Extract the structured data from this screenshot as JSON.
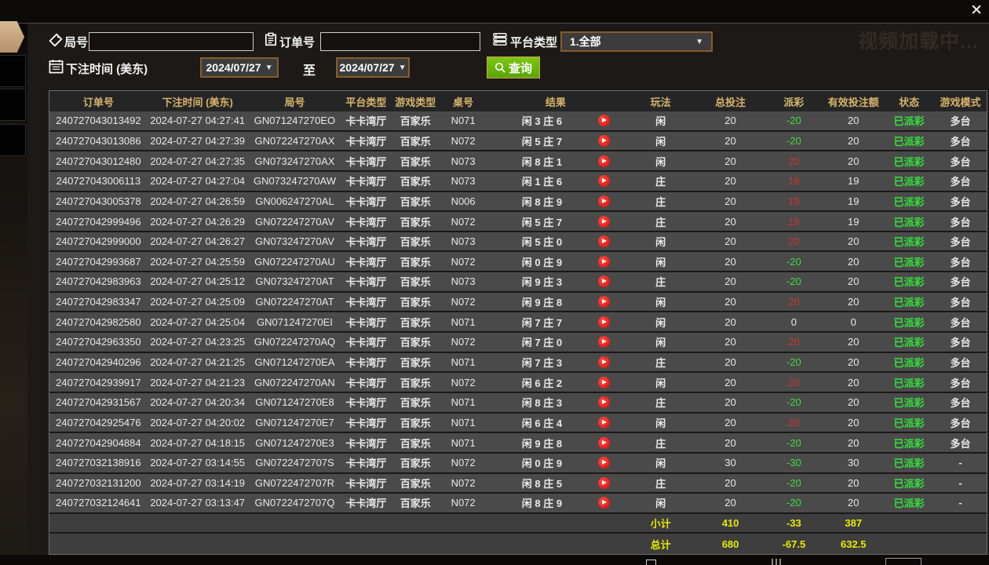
{
  "window": {
    "close_label": "✕"
  },
  "background": {
    "video_loading_text": "视频加载中..."
  },
  "filters": {
    "game_no_label": "局号",
    "game_no_value": "",
    "order_no_label": "订单号",
    "order_no_value": "",
    "platform_label": "平台类型",
    "platform_value": "1.全部",
    "bet_time_label": "下注时间 (美东)",
    "date_from": "2024/07/27",
    "to_label": "至",
    "date_to": "2024/07/27",
    "query_label": "查询",
    "dropdown_arrow": "▼"
  },
  "table": {
    "columns": [
      "订单号",
      "下注时间 (美东)",
      "局号",
      "平台类型",
      "游戏类型",
      "桌号",
      "结果",
      "玩法",
      "总投注",
      "派彩",
      "有效投注额",
      "状态",
      "游戏模式"
    ],
    "rows": [
      {
        "order_id": "240727043013492",
        "bet_time": "2024-07-27 04:27:41",
        "game_no": "GN071247270EO",
        "platform": "卡卡湾厅",
        "game_type": "百家乐",
        "table_no": "N071",
        "result": "闲 3 庄 6",
        "play": "闲",
        "total_bet": "20",
        "payout": "-20",
        "valid_bet": "20",
        "status": "已派彩",
        "mode": "多台"
      },
      {
        "order_id": "240727043013086",
        "bet_time": "2024-07-27 04:27:39",
        "game_no": "GN072247270AX",
        "platform": "卡卡湾厅",
        "game_type": "百家乐",
        "table_no": "N072",
        "result": "闲 5 庄 7",
        "play": "闲",
        "total_bet": "20",
        "payout": "-20",
        "valid_bet": "20",
        "status": "已派彩",
        "mode": "多台"
      },
      {
        "order_id": "240727043012480",
        "bet_time": "2024-07-27 04:27:35",
        "game_no": "GN073247270AX",
        "platform": "卡卡湾厅",
        "game_type": "百家乐",
        "table_no": "N073",
        "result": "闲 8 庄 1",
        "play": "闲",
        "total_bet": "20",
        "payout": "20",
        "valid_bet": "20",
        "status": "已派彩",
        "mode": "多台"
      },
      {
        "order_id": "240727043006113",
        "bet_time": "2024-07-27 04:27:04",
        "game_no": "GN073247270AW",
        "platform": "卡卡湾厅",
        "game_type": "百家乐",
        "table_no": "N073",
        "result": "闲 1 庄 6",
        "play": "庄",
        "total_bet": "20",
        "payout": "19",
        "valid_bet": "19",
        "status": "已派彩",
        "mode": "多台"
      },
      {
        "order_id": "240727043005378",
        "bet_time": "2024-07-27 04:26:59",
        "game_no": "GN006247270AL",
        "platform": "卡卡湾厅",
        "game_type": "百家乐",
        "table_no": "N006",
        "result": "闲 8 庄 9",
        "play": "庄",
        "total_bet": "20",
        "payout": "19",
        "valid_bet": "19",
        "status": "已派彩",
        "mode": "多台"
      },
      {
        "order_id": "240727042999496",
        "bet_time": "2024-07-27 04:26:29",
        "game_no": "GN072247270AV",
        "platform": "卡卡湾厅",
        "game_type": "百家乐",
        "table_no": "N072",
        "result": "闲 5 庄 7",
        "play": "庄",
        "total_bet": "20",
        "payout": "19",
        "valid_bet": "19",
        "status": "已派彩",
        "mode": "多台"
      },
      {
        "order_id": "240727042999000",
        "bet_time": "2024-07-27 04:26:27",
        "game_no": "GN073247270AV",
        "platform": "卡卡湾厅",
        "game_type": "百家乐",
        "table_no": "N073",
        "result": "闲 5 庄 0",
        "play": "闲",
        "total_bet": "20",
        "payout": "20",
        "valid_bet": "20",
        "status": "已派彩",
        "mode": "多台"
      },
      {
        "order_id": "240727042993687",
        "bet_time": "2024-07-27 04:25:59",
        "game_no": "GN072247270AU",
        "platform": "卡卡湾厅",
        "game_type": "百家乐",
        "table_no": "N072",
        "result": "闲 0 庄 9",
        "play": "闲",
        "total_bet": "20",
        "payout": "-20",
        "valid_bet": "20",
        "status": "已派彩",
        "mode": "多台"
      },
      {
        "order_id": "240727042983963",
        "bet_time": "2024-07-27 04:25:12",
        "game_no": "GN073247270AT",
        "platform": "卡卡湾厅",
        "game_type": "百家乐",
        "table_no": "N073",
        "result": "闲 9 庄 3",
        "play": "庄",
        "total_bet": "20",
        "payout": "-20",
        "valid_bet": "20",
        "status": "已派彩",
        "mode": "多台"
      },
      {
        "order_id": "240727042983347",
        "bet_time": "2024-07-27 04:25:09",
        "game_no": "GN072247270AT",
        "platform": "卡卡湾厅",
        "game_type": "百家乐",
        "table_no": "N072",
        "result": "闲 9 庄 8",
        "play": "闲",
        "total_bet": "20",
        "payout": "20",
        "valid_bet": "20",
        "status": "已派彩",
        "mode": "多台"
      },
      {
        "order_id": "240727042982580",
        "bet_time": "2024-07-27 04:25:04",
        "game_no": "GN071247270EI",
        "platform": "卡卡湾厅",
        "game_type": "百家乐",
        "table_no": "N071",
        "result": "闲 7 庄 7",
        "play": "闲",
        "total_bet": "20",
        "payout": "0",
        "valid_bet": "0",
        "status": "已派彩",
        "mode": "多台"
      },
      {
        "order_id": "240727042963350",
        "bet_time": "2024-07-27 04:23:25",
        "game_no": "GN072247270AQ",
        "platform": "卡卡湾厅",
        "game_type": "百家乐",
        "table_no": "N072",
        "result": "闲 7 庄 0",
        "play": "闲",
        "total_bet": "20",
        "payout": "20",
        "valid_bet": "20",
        "status": "已派彩",
        "mode": "多台"
      },
      {
        "order_id": "240727042940296",
        "bet_time": "2024-07-27 04:21:25",
        "game_no": "GN071247270EA",
        "platform": "卡卡湾厅",
        "game_type": "百家乐",
        "table_no": "N071",
        "result": "闲 7 庄 3",
        "play": "庄",
        "total_bet": "20",
        "payout": "-20",
        "valid_bet": "20",
        "status": "已派彩",
        "mode": "多台"
      },
      {
        "order_id": "240727042939917",
        "bet_time": "2024-07-27 04:21:23",
        "game_no": "GN072247270AN",
        "platform": "卡卡湾厅",
        "game_type": "百家乐",
        "table_no": "N072",
        "result": "闲 6 庄 2",
        "play": "闲",
        "total_bet": "20",
        "payout": "20",
        "valid_bet": "20",
        "status": "已派彩",
        "mode": "多台"
      },
      {
        "order_id": "240727042931567",
        "bet_time": "2024-07-27 04:20:34",
        "game_no": "GN071247270E8",
        "platform": "卡卡湾厅",
        "game_type": "百家乐",
        "table_no": "N071",
        "result": "闲 8 庄 3",
        "play": "庄",
        "total_bet": "20",
        "payout": "-20",
        "valid_bet": "20",
        "status": "已派彩",
        "mode": "多台"
      },
      {
        "order_id": "240727042925476",
        "bet_time": "2024-07-27 04:20:02",
        "game_no": "GN071247270E7",
        "platform": "卡卡湾厅",
        "game_type": "百家乐",
        "table_no": "N071",
        "result": "闲 6 庄 4",
        "play": "闲",
        "total_bet": "20",
        "payout": "20",
        "valid_bet": "20",
        "status": "已派彩",
        "mode": "多台"
      },
      {
        "order_id": "240727042904884",
        "bet_time": "2024-07-27 04:18:15",
        "game_no": "GN071247270E3",
        "platform": "卡卡湾厅",
        "game_type": "百家乐",
        "table_no": "N071",
        "result": "闲 9 庄 8",
        "play": "庄",
        "total_bet": "20",
        "payout": "-20",
        "valid_bet": "20",
        "status": "已派彩",
        "mode": "多台"
      },
      {
        "order_id": "240727032138916",
        "bet_time": "2024-07-27 03:14:55",
        "game_no": "GN0722472707S",
        "platform": "卡卡湾厅",
        "game_type": "百家乐",
        "table_no": "N072",
        "result": "闲 0 庄 9",
        "play": "闲",
        "total_bet": "30",
        "payout": "-30",
        "valid_bet": "30",
        "status": "已派彩",
        "mode": "-"
      },
      {
        "order_id": "240727032131200",
        "bet_time": "2024-07-27 03:14:19",
        "game_no": "GN0722472707R",
        "platform": "卡卡湾厅",
        "game_type": "百家乐",
        "table_no": "N072",
        "result": "闲 8 庄 5",
        "play": "庄",
        "total_bet": "20",
        "payout": "-20",
        "valid_bet": "20",
        "status": "已派彩",
        "mode": "-"
      },
      {
        "order_id": "240727032124641",
        "bet_time": "2024-07-27 03:13:47",
        "game_no": "GN0722472707Q",
        "platform": "卡卡湾厅",
        "game_type": "百家乐",
        "table_no": "N072",
        "result": "闲 8 庄 9",
        "play": "闲",
        "total_bet": "20",
        "payout": "-20",
        "valid_bet": "20",
        "status": "已派彩",
        "mode": "-"
      }
    ],
    "subtotal": {
      "label": "小计",
      "total_bet": "410",
      "payout": "-33",
      "valid_bet": "387"
    },
    "total": {
      "label": "总计",
      "total_bet": "680",
      "payout": "-67.5",
      "valid_bet": "632.5"
    }
  },
  "colors": {
    "win_payout": "#cf3429",
    "loss_payout": "#3fdd3a",
    "paid_status": "#35e03c",
    "summary_yellow": "#e9ea00",
    "header_gold": "#d8b46c",
    "query_green": "#6bb80c",
    "accent_border": "#8a5c28"
  }
}
